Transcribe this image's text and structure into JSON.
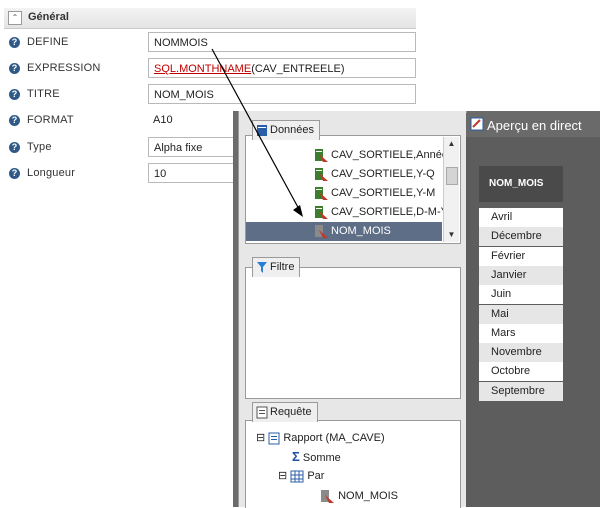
{
  "section": {
    "title": "Général",
    "collapse_glyph": "⌃"
  },
  "properties": [
    {
      "label": "DEFINE",
      "value": "NOMMOIS"
    },
    {
      "label": "EXPRESSION",
      "value_fn": "SQL.MONTHNAME",
      "value_rest": "(CAV_ENTREELE)"
    },
    {
      "label": "TITRE",
      "value": "NOM_MOIS"
    },
    {
      "label": "FORMAT",
      "value": "A10"
    },
    {
      "label": "Type",
      "value": "Alpha fixe"
    },
    {
      "label": "Longueur",
      "value": "10"
    }
  ],
  "help_glyph": "?",
  "data_panel": {
    "title": "Données",
    "fields": [
      {
        "label": "CAV_SORTIELE,Année"
      },
      {
        "label": "CAV_SORTIELE,Y-Q"
      },
      {
        "label": "CAV_SORTIELE,Y-M"
      },
      {
        "label": "CAV_SORTIELE,D-M-Y"
      },
      {
        "label": "NOM_MOIS",
        "selected": true
      }
    ]
  },
  "filter_panel": {
    "title": "Filtre"
  },
  "request_panel": {
    "title": "Requête",
    "tree": [
      {
        "label": "Rapport (MA_CAVE)",
        "expander": "⊟"
      },
      {
        "label": "Somme"
      },
      {
        "label": "Par",
        "expander": "⊟"
      },
      {
        "label": "NOM_MOIS"
      }
    ]
  },
  "preview": {
    "title": "Aperçu en direct",
    "column_header": "NOM_MOIS",
    "months": [
      "Avril",
      "Décembre",
      "Février",
      "Janvier",
      "Juin",
      "Mai",
      "Mars",
      "Novembre",
      "Octobre",
      "Septembre"
    ]
  },
  "colors": {
    "selected_row": "#5e6e86",
    "help_icon": "#2f5a87",
    "expression_highlight": "#c00000"
  }
}
